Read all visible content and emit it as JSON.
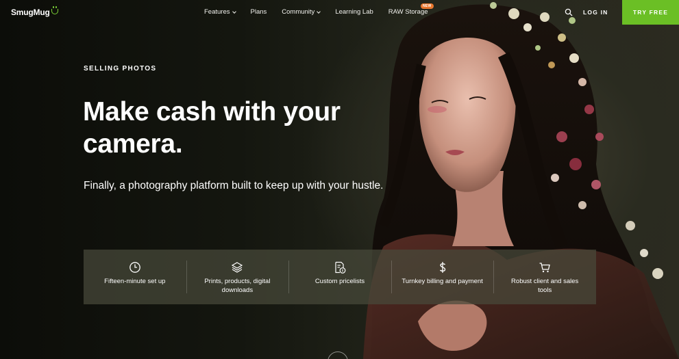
{
  "brand": {
    "name": "SmugMug",
    "accent": "#6bbf25"
  },
  "nav": {
    "links": [
      {
        "label": "Features",
        "has_dropdown": true
      },
      {
        "label": "Plans",
        "has_dropdown": false
      },
      {
        "label": "Community",
        "has_dropdown": true
      },
      {
        "label": "Learning Lab",
        "has_dropdown": false
      },
      {
        "label": "RAW Storage",
        "has_dropdown": false,
        "badge": "NEW"
      }
    ],
    "search_icon": "search-icon",
    "login_label": "LOG IN",
    "cta_label": "TRY FREE"
  },
  "hero": {
    "eyebrow": "SELLING PHOTOS",
    "headline": "Make cash with your camera.",
    "subhead": "Finally, a photography platform built to keep up with your hustle."
  },
  "features": [
    {
      "icon": "clock-icon",
      "label": "Fifteen-minute set up"
    },
    {
      "icon": "layers-icon",
      "label": "Prints, products, digital downloads"
    },
    {
      "icon": "pricelist-icon",
      "label": "Custom pricelists"
    },
    {
      "icon": "dollar-icon",
      "label": "Turnkey billing and payment"
    },
    {
      "icon": "cart-icon",
      "label": "Robust client and sales tools"
    }
  ]
}
